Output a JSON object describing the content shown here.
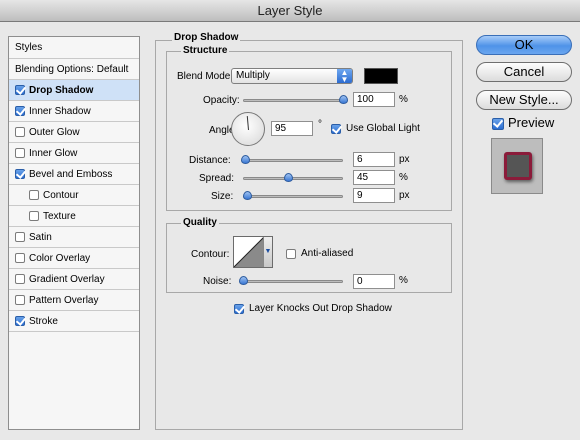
{
  "window": {
    "title": "Layer Style"
  },
  "sidebar": {
    "header": "Styles",
    "blending": "Blending Options: Default",
    "items": [
      {
        "label": "Drop Shadow",
        "checked": true,
        "selected": true
      },
      {
        "label": "Inner Shadow",
        "checked": true
      },
      {
        "label": "Outer Glow",
        "checked": false
      },
      {
        "label": "Inner Glow",
        "checked": false
      },
      {
        "label": "Bevel and Emboss",
        "checked": true
      },
      {
        "label": "Contour",
        "checked": false,
        "indent": true
      },
      {
        "label": "Texture",
        "checked": false,
        "indent": true
      },
      {
        "label": "Satin",
        "checked": false
      },
      {
        "label": "Color Overlay",
        "checked": false
      },
      {
        "label": "Gradient Overlay",
        "checked": false
      },
      {
        "label": "Pattern Overlay",
        "checked": false
      },
      {
        "label": "Stroke",
        "checked": true
      }
    ]
  },
  "section": {
    "title": "Drop Shadow"
  },
  "structure": {
    "title": "Structure",
    "blend_mode_label": "Blend Mode:",
    "blend_mode_value": "Multiply",
    "opacity_label": "Opacity:",
    "opacity_value": "100",
    "opacity_unit": "%",
    "opacity_level": 1.0,
    "angle_label": "Angle:",
    "angle_value": "95",
    "angle_unit": "°",
    "global_light_label": "Use Global Light",
    "distance_label": "Distance:",
    "distance_value": "6",
    "distance_unit": "px",
    "distance_level": 0.02,
    "spread_label": "Spread:",
    "spread_value": "45",
    "spread_unit": "%",
    "spread_level": 0.45,
    "size_label": "Size:",
    "size_value": "9",
    "size_unit": "px",
    "size_level": 0.04,
    "shadow_color": "#000000"
  },
  "quality": {
    "title": "Quality",
    "contour_label": "Contour:",
    "anti_aliased_label": "Anti-aliased",
    "noise_label": "Noise:",
    "noise_value": "0",
    "noise_unit": "%",
    "noise_level": 0.0
  },
  "knockout_label": "Layer Knocks Out Drop Shadow",
  "buttons": {
    "ok": "OK",
    "cancel": "Cancel",
    "new_style": "New Style...",
    "preview": "Preview"
  },
  "colors": {
    "accent": "#4f93e8",
    "selected_row": "#cfe1f7",
    "preview_swatch": "#8b1b3a"
  }
}
